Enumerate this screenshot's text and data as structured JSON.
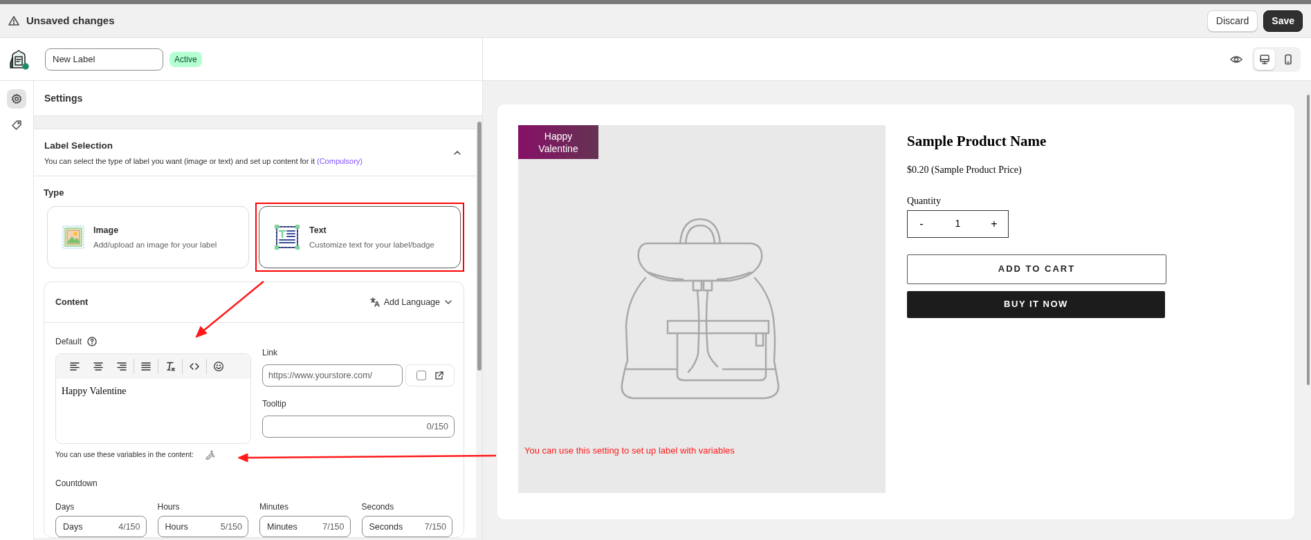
{
  "top_bar": {
    "title": "Unsaved changes",
    "buttons": [
      {
        "label": "Discard",
        "kind": "secondary"
      },
      {
        "label": "Save",
        "kind": "primary"
      }
    ]
  },
  "header": {
    "name_value": "New Label",
    "status": "Active",
    "view_modes": [
      {
        "kind": "desktop",
        "selected": true
      },
      {
        "kind": "mobile",
        "selected": false
      }
    ]
  },
  "rail": [
    {
      "kind": "settings",
      "selected": true
    },
    {
      "kind": "tag",
      "selected": false
    }
  ],
  "settings": {
    "title": "Settings",
    "section": {
      "title": "Label Selection",
      "description": "You can select the type of label you want (image or text) and set up content for it",
      "tag": "(Compulsory)",
      "expanded": true
    },
    "type_label": "Type",
    "types": [
      {
        "kind": "image",
        "title": "Image",
        "description": "Add/upload an image for your label",
        "selected": false,
        "highlighted": false
      },
      {
        "kind": "text",
        "title": "Text",
        "description": "Customize text for your label/badge",
        "selected": true,
        "highlighted": true
      }
    ],
    "content": {
      "title": "Content",
      "add_language": "Add Language",
      "default_label": "Default",
      "editor_text": "Happy Valentine",
      "link_label": "Link",
      "link_placeholder": "https://www.yourstore.com/",
      "link_new_tab_checked": false,
      "tooltip_label": "Tooltip",
      "tooltip_counter": "0/150",
      "variables_hint": "You can use these variables in the content:",
      "countdown_label": "Countdown",
      "countdown": [
        {
          "label": "Days",
          "value": "Days",
          "counter": "4/150"
        },
        {
          "label": "Hours",
          "value": "Hours",
          "counter": "5/150"
        },
        {
          "label": "Minutes",
          "value": "Minutes",
          "counter": "7/150"
        },
        {
          "label": "Seconds",
          "value": "Seconds",
          "counter": "7/150"
        }
      ]
    }
  },
  "preview": {
    "badge": "Happy Valentine",
    "annotation": "You can use this setting to set up label with variables",
    "product_name": "Sample Product Name",
    "price": "$0.20 (Sample Product Price)",
    "quantity_label": "Quantity",
    "minus": "-",
    "quantity": "1",
    "plus": "+",
    "add_to_cart": "ADD TO CART",
    "buy_now": "BUY IT NOW"
  }
}
